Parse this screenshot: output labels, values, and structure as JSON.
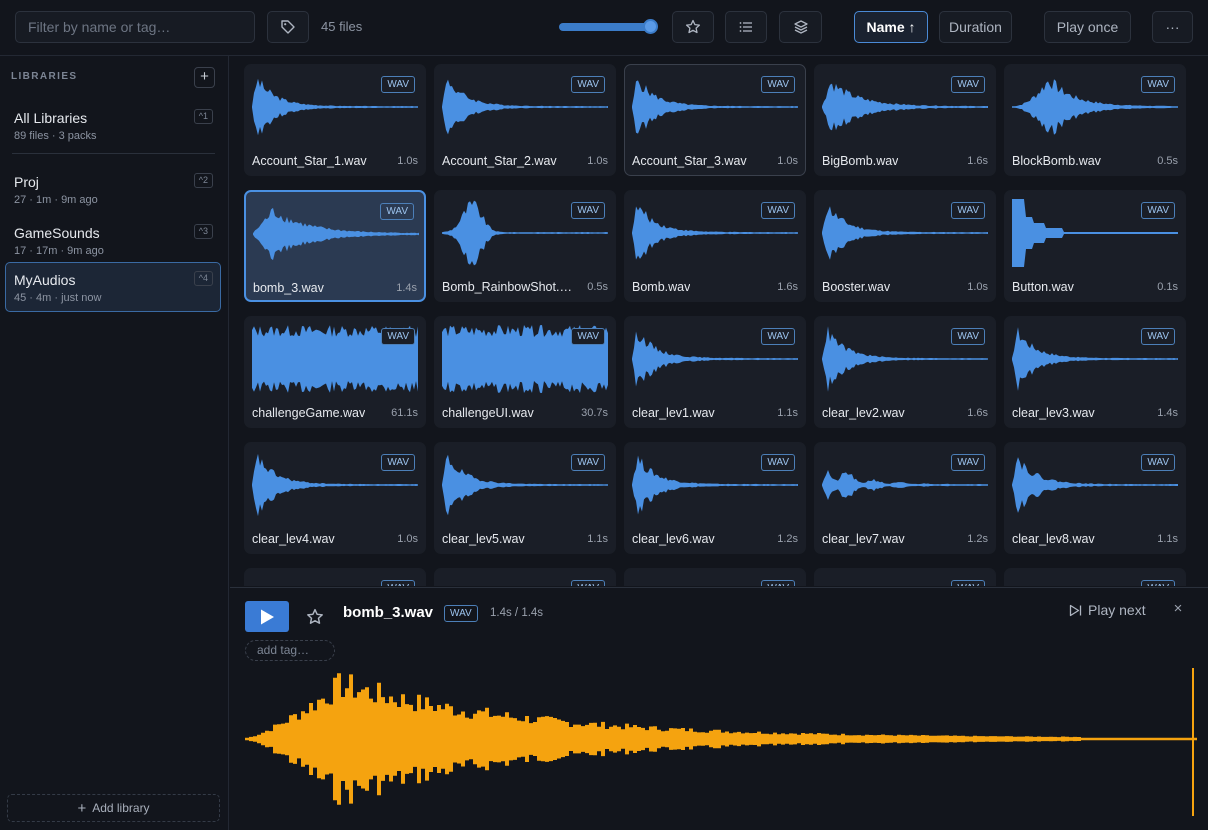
{
  "toolbar": {
    "search_placeholder": "Filter by name or tag…",
    "file_count": "45 files",
    "zoom_level": 0.87,
    "sort_name_label": "Name ↑",
    "sort_duration_label": "Duration",
    "play_mode_label": "Play once",
    "more_label": "···"
  },
  "sidebar": {
    "header": "LIBRARIES",
    "items": [
      {
        "name": "All Libraries",
        "meta": "89 files · 3 packs",
        "key": "^1"
      },
      {
        "name": "Proj",
        "meta": "27 · 1m · 9m ago",
        "key": "^2"
      },
      {
        "name": "GameSounds",
        "meta": "17 · 17m · 9m ago",
        "key": "^3"
      },
      {
        "name": "MyAudios",
        "meta": "45 · 4m · just now",
        "key": "^4"
      }
    ],
    "add_library_label": "Add library"
  },
  "grid": {
    "badge": "WAV",
    "files": [
      {
        "name": "Account_Star_1.wav",
        "duration": "1.0s"
      },
      {
        "name": "Account_Star_2.wav",
        "duration": "1.0s"
      },
      {
        "name": "Account_Star_3.wav",
        "duration": "1.0s"
      },
      {
        "name": "BigBomb.wav",
        "duration": "1.6s"
      },
      {
        "name": "BlockBomb.wav",
        "duration": "0.5s"
      },
      {
        "name": "bomb_3.wav",
        "duration": "1.4s"
      },
      {
        "name": "Bomb_RainbowShot.wav",
        "duration": "0.5s"
      },
      {
        "name": "Bomb.wav",
        "duration": "1.6s"
      },
      {
        "name": "Booster.wav",
        "duration": "1.0s"
      },
      {
        "name": "Button.wav",
        "duration": "0.1s"
      },
      {
        "name": "challengeGame.wav",
        "duration": "61.1s"
      },
      {
        "name": "challengeUI.wav",
        "duration": "30.7s"
      },
      {
        "name": "clear_lev1.wav",
        "duration": "1.1s"
      },
      {
        "name": "clear_lev2.wav",
        "duration": "1.6s"
      },
      {
        "name": "clear_lev3.wav",
        "duration": "1.4s"
      },
      {
        "name": "clear_lev4.wav",
        "duration": "1.0s"
      },
      {
        "name": "clear_lev5.wav",
        "duration": "1.1s"
      },
      {
        "name": "clear_lev6.wav",
        "duration": "1.2s"
      },
      {
        "name": "clear_lev7.wav",
        "duration": "1.2s"
      },
      {
        "name": "clear_lev8.wav",
        "duration": "1.1s"
      }
    ]
  },
  "player": {
    "title": "bomb_3.wav",
    "badge": "WAV",
    "time": "1.4s / 1.4s",
    "play_next_label": "Play next",
    "add_tag_placeholder": "add tag…",
    "close_label": "×"
  },
  "colors": {
    "accent": "#3a7bd5",
    "waveform": "#4a90e2",
    "player_waveform": "#f5a30f"
  }
}
